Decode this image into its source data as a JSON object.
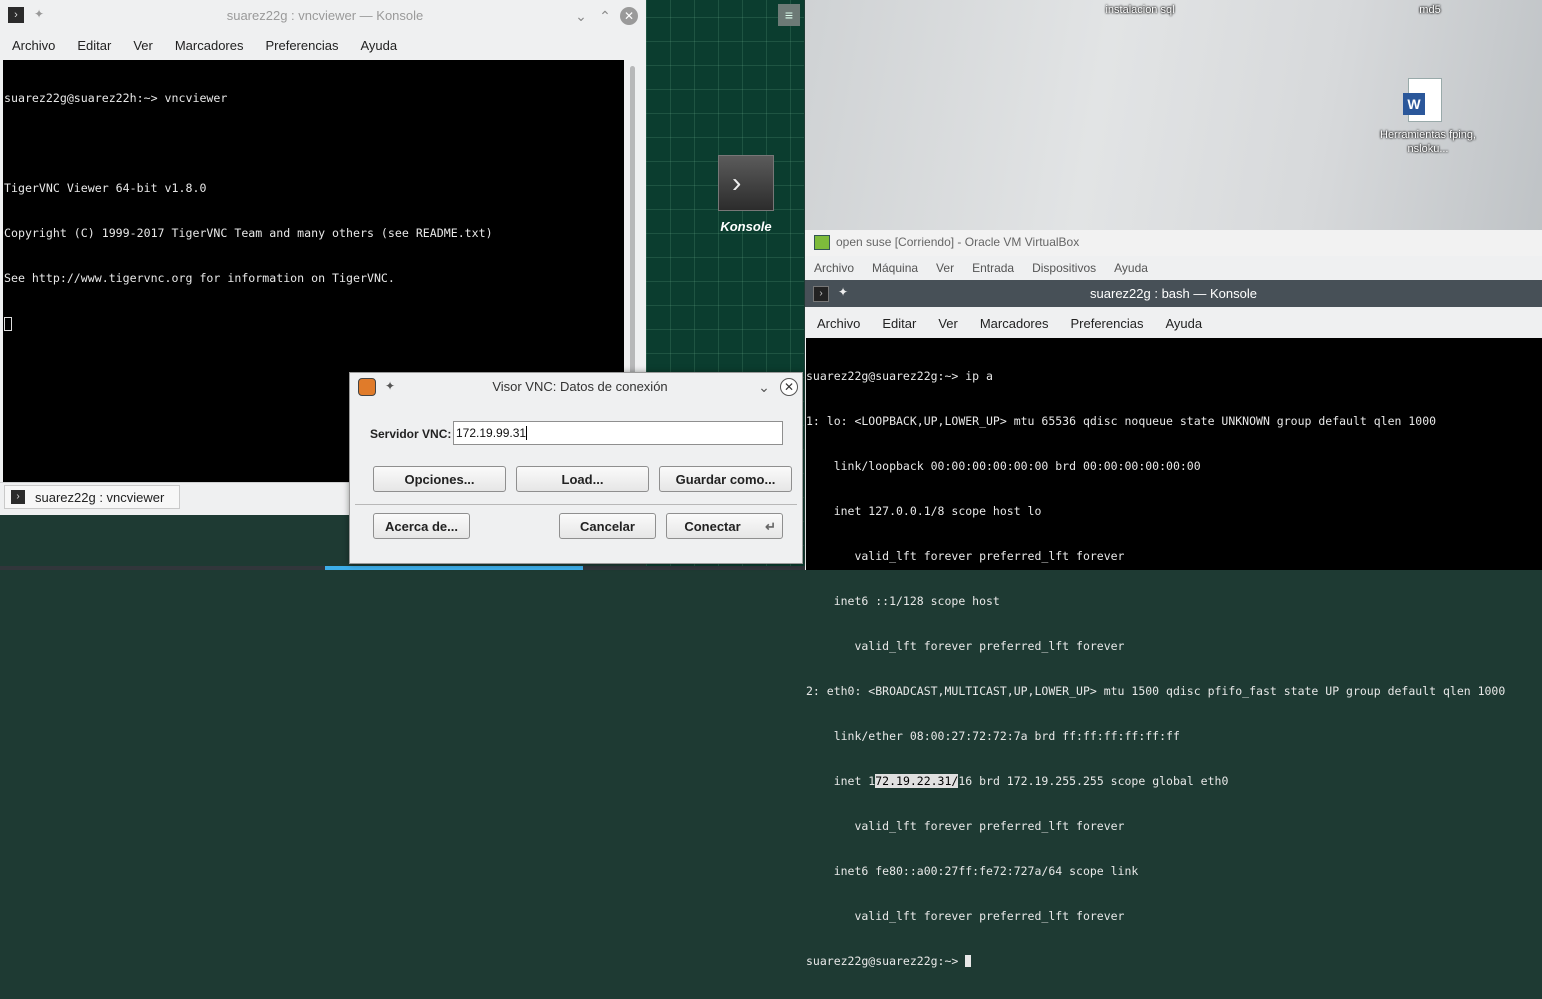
{
  "konsole1": {
    "title": "suarez22g : vncviewer — Konsole",
    "menu": [
      "Archivo",
      "Editar",
      "Ver",
      "Marcadores",
      "Preferencias",
      "Ayuda"
    ],
    "lines": [
      "suarez22g@suarez22h:~> vncviewer",
      "",
      "TigerVNC Viewer 64-bit v1.8.0",
      "Copyright (C) 1999-2017 TigerVNC Team and many others (see README.txt)",
      "See http://www.tigervnc.org for information on TigerVNC."
    ],
    "tab_label": "suarez22g : vncviewer"
  },
  "launcher": {
    "label": "Konsole"
  },
  "desktop": {
    "icons": [
      {
        "label": "instalacion sql"
      },
      {
        "label": "md5"
      },
      {
        "label": "Herramientas fping, nsloku..."
      }
    ]
  },
  "virtualbox": {
    "title": "open suse [Corriendo] - Oracle VM VirtualBox",
    "menu": [
      "Archivo",
      "Máquina",
      "Ver",
      "Entrada",
      "Dispositivos",
      "Ayuda"
    ]
  },
  "konsole2": {
    "title": "suarez22g : bash — Konsole",
    "menu": [
      "Archivo",
      "Editar",
      "Ver",
      "Marcadores",
      "Preferencias",
      "Ayuda"
    ],
    "lines": [
      "suarez22g@suarez22g:~> ip a",
      "1: lo: <LOOPBACK,UP,LOWER_UP> mtu 65536 qdisc noqueue state UNKNOWN group default qlen 1000",
      "    link/loopback 00:00:00:00:00:00 brd 00:00:00:00:00:00",
      "    inet 127.0.0.1/8 scope host lo",
      "       valid_lft forever preferred_lft forever",
      "    inet6 ::1/128 scope host",
      "       valid_lft forever preferred_lft forever",
      "2: eth0: <BROADCAST,MULTICAST,UP,LOWER_UP> mtu 1500 qdisc pfifo_fast state UP group default qlen 1000",
      "    link/ether 08:00:27:72:72:7a brd ff:ff:ff:ff:ff:ff",
      "    inet 1",
      "       valid_lft forever preferred_lft forever",
      "    inet6 fe80::a00:27ff:fe72:727a/64 scope link",
      "       valid_lft forever preferred_lft forever",
      "suarez22g@suarez22g:~> "
    ],
    "inet_highlight": "72.19.22.31/",
    "inet_rest": "16 brd 172.19.255.255 scope global eth0"
  },
  "vnc_dialog": {
    "title": "Visor VNC: Datos de conexión",
    "server_label": "Servidor VNC:",
    "server_value": "172.19.99.31",
    "btn_options": "Opciones...",
    "btn_load": "Load...",
    "btn_save": "Guardar como...",
    "btn_about": "Acerca de...",
    "btn_cancel": "Cancelar",
    "btn_connect": "Conectar"
  }
}
